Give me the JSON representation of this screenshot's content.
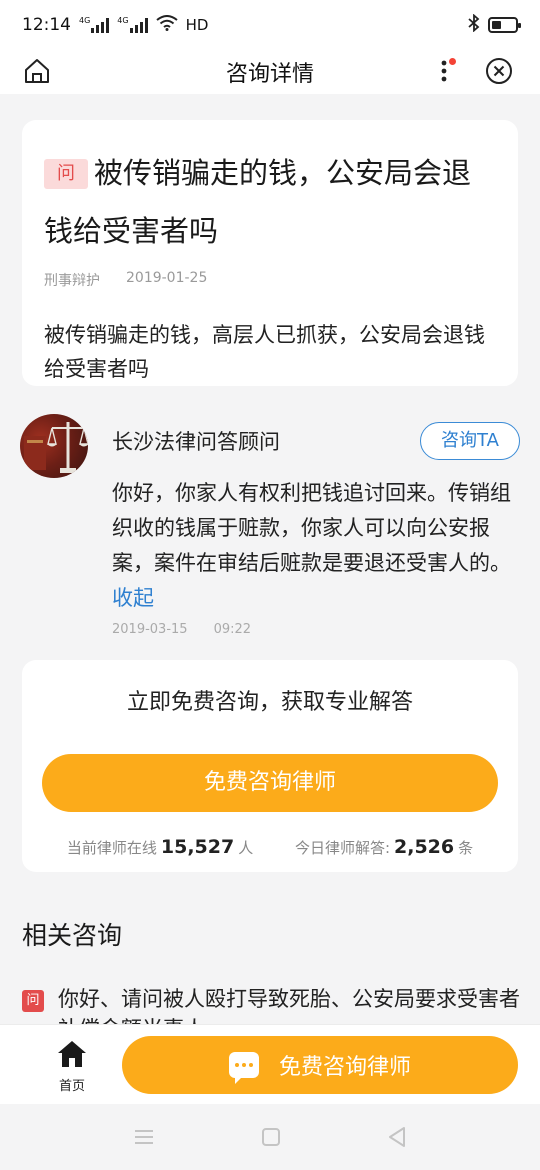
{
  "status_bar": {
    "time": "12:14",
    "network_1": "4G",
    "network_2": "4G",
    "hd": "HD"
  },
  "nav": {
    "title": "咨询详情"
  },
  "question": {
    "tag": "问",
    "title": "被传销骗走的钱，公安局会退钱给受害者吗",
    "category": "刑事辩护",
    "date": "2019-01-25",
    "body": "被传销骗走的钱，高层人已抓获，公安局会退钱给受害者吗"
  },
  "answer": {
    "lawyer_name": "长沙法律问答顾问",
    "consult_label": "咨询TA",
    "text": "你好，你家人有权利把钱追讨回来。传销组织收的钱属于赃款，你家人可以向公安报案，案件在审结后赃款是要退还受害人的。",
    "collapse_label": "收起",
    "date": "2019-03-15",
    "time": "09:22"
  },
  "cta": {
    "heading": "立即免费咨询，获取专业解答",
    "button_label": "免费咨询律师",
    "online_label": "当前律师在线",
    "online_count": "15,527",
    "online_unit": "人",
    "answered_label": "今日律师解答:",
    "answered_count": "2,526",
    "answered_unit": "条"
  },
  "related": {
    "title": "相关咨询",
    "items": [
      {
        "tag": "问",
        "text": "你好、请问被人殴打导致死胎、公安局要求受害者补偿金额当事人"
      }
    ]
  },
  "bottom_bar": {
    "home_label": "首页",
    "cta_label": "免费咨询律师"
  },
  "colors": {
    "accent": "#fcab1a",
    "link": "#2f80d0",
    "tag_red": "#e34c4c"
  }
}
